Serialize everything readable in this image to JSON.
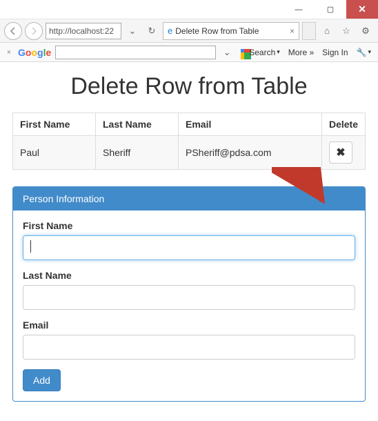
{
  "window": {
    "minimize": "—",
    "maximize": "▢",
    "close": "✕"
  },
  "addressbar": {
    "url": "http://localhost:22",
    "dropdown": "⌄",
    "refresh_icon": "↻",
    "lock_icon": "🔒"
  },
  "tab": {
    "ie_glyph": "e",
    "title": "Delete Row from Table",
    "close": "×"
  },
  "right_icons": {
    "home": "⌂",
    "star": "☆",
    "gear": "⚙"
  },
  "gtoolbar": {
    "close": "×",
    "logo_chars": [
      "G",
      "o",
      "o",
      "g",
      "l",
      "e"
    ],
    "search_value": "",
    "search_dropdown": "⌄",
    "search_btn": "Search",
    "search_btn_dropdown": "▾",
    "more_btn": "More »",
    "signin_btn": "Sign In",
    "wrench": "🔧",
    "wrench_dropdown": "▾"
  },
  "page": {
    "heading": "Delete Row from Table",
    "table": {
      "headers": [
        "First Name",
        "Last Name",
        "Email",
        "Delete"
      ],
      "row": {
        "first_name": "Paul",
        "last_name": "Sheriff",
        "email": "PSheriff@pdsa.com",
        "delete_icon": "✖"
      }
    },
    "panel": {
      "title": "Person Information",
      "fields": {
        "first_name_label": "First Name",
        "first_name_value": "",
        "last_name_label": "Last Name",
        "last_name_value": "",
        "email_label": "Email",
        "email_value": ""
      },
      "add_button": "Add"
    }
  }
}
